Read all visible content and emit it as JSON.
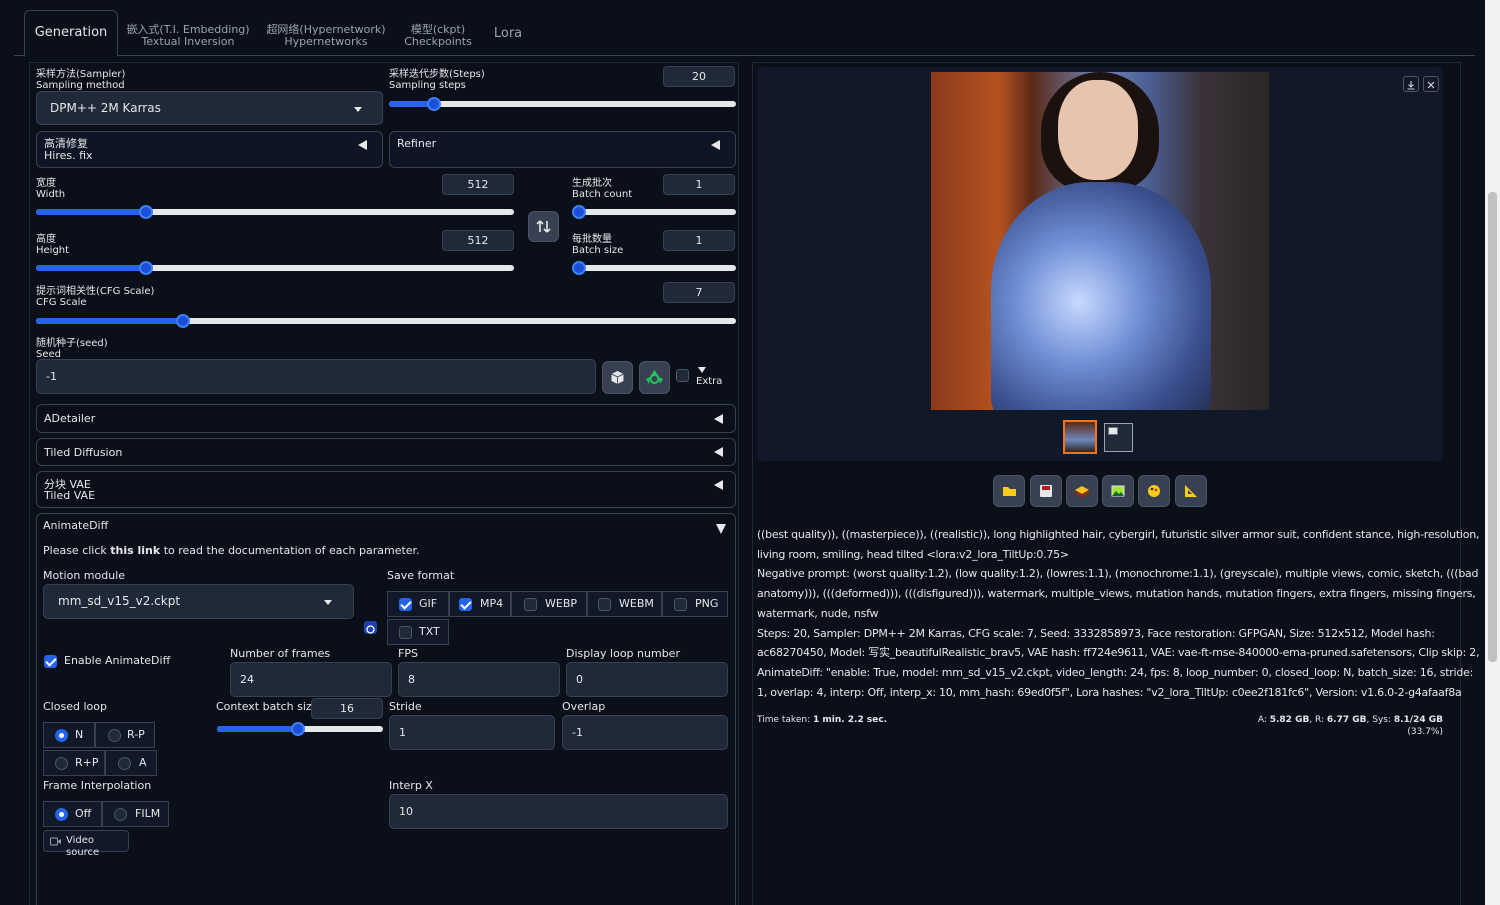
{
  "tabs": {
    "generation": "Generation",
    "embed_zh": "嵌入式(T.I. Embedding)",
    "embed_en": "Textual Inversion",
    "hyper_zh": "超网络(Hypernetwork)",
    "hyper_en": "Hypernetworks",
    "ckpt_zh": "模型(ckpt)",
    "ckpt_en": "Checkpoints",
    "lora": "Lora"
  },
  "sampler": {
    "label_zh": "采样方法(Sampler)",
    "label_en": "Sampling method",
    "value": "DPM++ 2M Karras"
  },
  "steps": {
    "label_zh": "采样迭代步数(Steps)",
    "label_en": "Sampling steps",
    "value": "20",
    "fraction": 0.13
  },
  "hires": {
    "label_zh": "高清修复",
    "label_en": "Hires. fix"
  },
  "refiner": {
    "label": "Refiner"
  },
  "width": {
    "label_zh": "宽度",
    "label_en": "Width",
    "value": "512",
    "fraction": 0.23
  },
  "height": {
    "label_zh": "高度",
    "label_en": "Height",
    "value": "512",
    "fraction": 0.23
  },
  "batch_count": {
    "label_zh": "生成批次",
    "label_en": "Batch count",
    "value": "1",
    "fraction": 0.0
  },
  "batch_size": {
    "label_zh": "每批数量",
    "label_en": "Batch size",
    "value": "1",
    "fraction": 0.0
  },
  "cfg": {
    "label_zh": "提示词相关性(CFG Scale)",
    "label_en": "CFG Scale",
    "value": "7",
    "fraction": 0.21
  },
  "seed": {
    "label_zh": "随机种子(seed)",
    "label_en": "Seed",
    "value": "-1",
    "extra": "Extra"
  },
  "accordions": {
    "adetailer": "ADetailer",
    "tiled_diffusion": "Tiled Diffusion",
    "tiled_vae_zh": "分块 VAE",
    "tiled_vae_en": "Tiled VAE"
  },
  "animatediff": {
    "title": "AnimateDiff",
    "doc_pre": "Please click ",
    "doc_link": "this link",
    "doc_post": " to read the documentation of each parameter.",
    "motion_module_label": "Motion module",
    "motion_module_value": "mm_sd_v15_v2.ckpt",
    "save_format_label": "Save format",
    "formats": {
      "gif": "GIF",
      "mp4": "MP4",
      "webp": "WEBP",
      "webm": "WEBM",
      "png": "PNG",
      "txt": "TXT"
    },
    "enable_label": "Enable AnimateDiff",
    "frames_label": "Number of frames",
    "frames_value": "24",
    "fps_label": "FPS",
    "fps_value": "8",
    "loop_label": "Display loop number",
    "loop_value": "0",
    "closed_loop_label": "Closed loop",
    "closed_opts": {
      "n": "N",
      "rp": "R-P",
      "rpp": "R+P",
      "a": "A"
    },
    "context_label": "Context batch size",
    "context_value": "16",
    "context_fraction": 0.49,
    "stride_label": "Stride",
    "stride_value": "1",
    "overlap_label": "Overlap",
    "overlap_value": "-1",
    "interp_label": "Frame Interpolation",
    "interp_opts": {
      "off": "Off",
      "film": "FILM"
    },
    "interp_x_label": "Interp X",
    "interp_x_value": "10",
    "video_source": "Video source"
  },
  "output": {
    "info_lines": [
      "((best quality)), ((masterpiece)), ((realistic)), long highlighted hair, cybergirl, futuristic silver armor suit, confident stance, high-resolution,",
      "living room, smiling, head tilted <lora:v2_lora_TiltUp:0.75>",
      "Negative prompt: (worst quality:1.2), (low quality:1.2), (lowres:1.1), (monochrome:1.1), (greyscale), multiple views, comic, sketch, (((bad",
      "anatomy))), (((deformed))), (((disfigured))), watermark, multiple_views, mutation hands, mutation fingers, extra fingers, missing fingers,",
      "watermark, nude, nsfw",
      "Steps: 20, Sampler: DPM++ 2M Karras, CFG scale: 7, Seed: 3332858973, Face restoration: GFPGAN, Size: 512x512, Model hash:",
      "ac68270450, Model: 写实_beautifulRealistic_brav5, VAE hash: ff724e9611, VAE: vae-ft-mse-840000-ema-pruned.safetensors, Clip skip: 2,",
      "AnimateDiff: \"enable: True, model: mm_sd_v15_v2.ckpt, video_length: 24, fps: 8, loop_number: 0, closed_loop: N, batch_size: 16, stride:",
      "1, overlap: 4, interp: Off, interp_x: 10, mm_hash: 69ed0f5f\", Lora hashes: \"v2_lora_TiltUp: c0ee2f181fc6\", Version: v1.6.0-2-g4afaaf8a"
    ],
    "time_label": "Time taken: ",
    "time_value": "1 min. 2.2 sec.",
    "mem_a_label": "A: ",
    "mem_a": "5.82 GB",
    "mem_r_label": ", R: ",
    "mem_r": "6.77 GB",
    "mem_sys_label": ", Sys: ",
    "mem_sys": "8.1/24 GB",
    "mem_pct": " (33.7%)"
  },
  "colors": {
    "bg": "#0b0f19",
    "accent": "#2563eb",
    "border": "#374151",
    "thumb_selected": "#f97316"
  },
  "icons": [
    "folder-icon",
    "save-icon",
    "zip-icon",
    "image-icon",
    "palette-icon",
    "ruler-icon",
    "dice-icon",
    "recycle-icon",
    "download-icon",
    "close-icon",
    "swap-icon",
    "refresh-icon",
    "video-icon",
    "dropdown-arrow-icon"
  ]
}
